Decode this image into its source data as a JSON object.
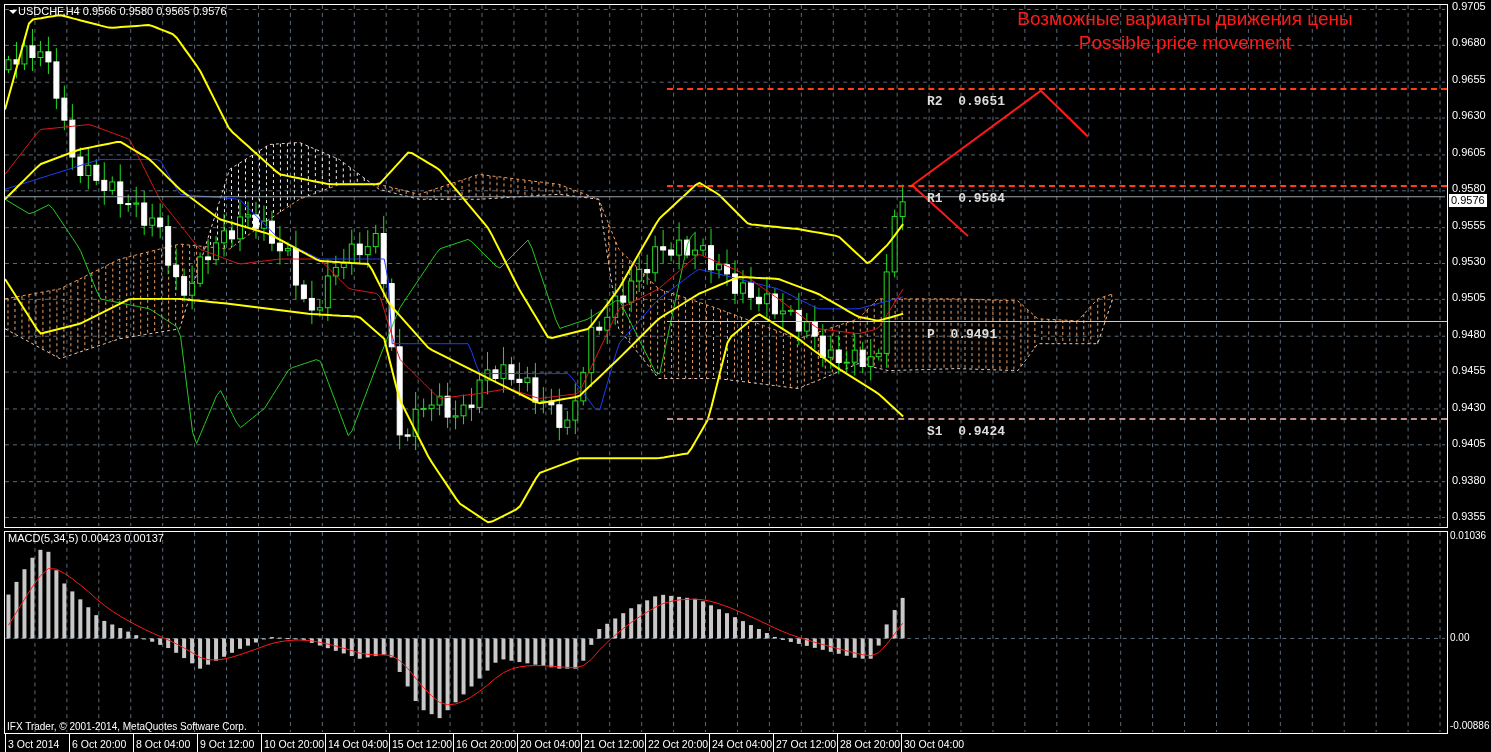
{
  "chart": {
    "title": "USDCHF,H4  0.9566 0.9580 0.9565 0.9576",
    "annotation": [
      "Возможные варианты движения цены",
      "Possible price movement"
    ],
    "levels": [
      {
        "label": "R2",
        "value": "0.9651",
        "color": "#ff3c14",
        "kind": "dashed"
      },
      {
        "label": "R1",
        "value": "0.9584",
        "color": "#ff3c14",
        "kind": "dashed"
      },
      {
        "label": "P",
        "value": "0.9491",
        "color": "#ffd700",
        "kind": "solid"
      },
      {
        "label": "S1",
        "value": "0.9424",
        "color": "#c09090",
        "kind": "dashed"
      }
    ],
    "price_ticks": [
      "0.9705",
      "0.9680",
      "0.9655",
      "0.9630",
      "0.9605",
      "0.9580",
      "0.9555",
      "0.9530",
      "0.9505",
      "0.9480",
      "0.9455",
      "0.9430",
      "0.9405",
      "0.9380",
      "0.9355"
    ],
    "current_price": "0.9576"
  },
  "indicator": {
    "title": "MACD(5,34,5) 0.00423 0.00137",
    "ticks": [
      "0.01036",
      "0.00",
      "-0.00886"
    ],
    "copyright": "IFX Trader, © 2001-2014, MetaQuotes Software Corp."
  },
  "time_axis": [
    "3 Oct 2014",
    "6 Oct 20:00",
    "8 Oct 04:00",
    "9 Oct 12:00",
    "10 Oct 20:00",
    "14 Oct 04:00",
    "15 Oct 12:00",
    "16 Oct 20:00",
    "20 Oct 04:00",
    "21 Oct 12:00",
    "22 Oct 20:00",
    "24 Oct 04:00",
    "27 Oct 12:00",
    "28 Oct 20:00",
    "30 Oct 04:00"
  ]
}
